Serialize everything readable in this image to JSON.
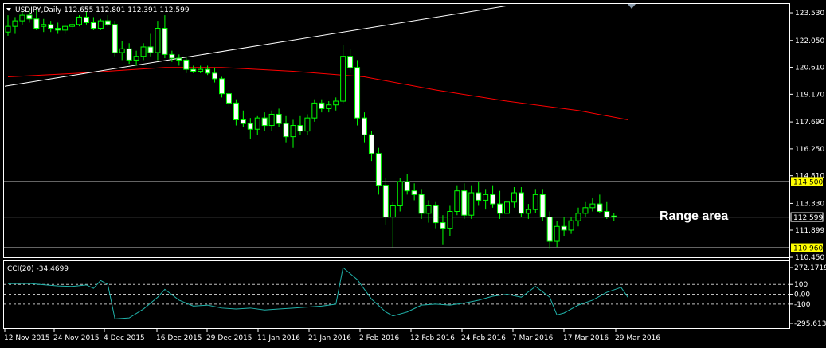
{
  "header": {
    "symbol_line": "USDJPY,Daily  112.655 112.801 112.391 112.599"
  },
  "price_axis": {
    "ticks": [
      "123.530",
      "122.050",
      "120.610",
      "119.170",
      "117.690",
      "116.250",
      "114.810",
      "113.330",
      "111.899",
      "110.450"
    ],
    "labels": [
      {
        "text": "114.500",
        "style": "yellow"
      },
      {
        "text": "112.599",
        "style": "white"
      },
      {
        "text": "110.960",
        "style": "yellow"
      }
    ]
  },
  "annotation": {
    "range_text": "Range area"
  },
  "cci": {
    "title": "CCI(20) -34.4699",
    "ticks": [
      "272.1719",
      "100",
      "0.00",
      "-100",
      "-295.6136"
    ]
  },
  "dates": [
    "12 Nov 2015",
    "24 Nov 2015",
    "4 Dec 2015",
    "16 Dec 2015",
    "29 Dec 2015",
    "11 Jan 2016",
    "21 Jan 2016",
    "2 Feb 2016",
    "12 Feb 2016",
    "24 Feb 2016",
    "7 Mar 2016",
    "17 Mar 2016",
    "29 Mar 2016"
  ],
  "colors": {
    "background": "#000000",
    "grid": "#ffffff",
    "bull_candle": "#000000",
    "bear_candle": "#ffffff",
    "wick": "#00ff00",
    "ma": "#ff0000",
    "trendline": "#ffffff",
    "cci_line": "#20b2aa",
    "level_label_bg": "#ffff00"
  },
  "chart_data": {
    "type": "candlestick",
    "symbol": "USDJPY",
    "timeframe": "Daily",
    "ylim": [
      110.45,
      124.0
    ],
    "candles": [
      {
        "o": 122.5,
        "h": 123.4,
        "l": 122.3,
        "c": 122.8
      },
      {
        "o": 122.8,
        "h": 123.3,
        "l": 122.4,
        "c": 123.1
      },
      {
        "o": 123.1,
        "h": 123.6,
        "l": 122.9,
        "c": 123.4
      },
      {
        "o": 123.4,
        "h": 123.8,
        "l": 123.0,
        "c": 123.2
      },
      {
        "o": 123.2,
        "h": 123.7,
        "l": 122.6,
        "c": 122.7
      },
      {
        "o": 122.8,
        "h": 123.2,
        "l": 122.5,
        "c": 122.9
      },
      {
        "o": 122.9,
        "h": 123.1,
        "l": 122.5,
        "c": 122.7
      },
      {
        "o": 122.7,
        "h": 123.0,
        "l": 122.4,
        "c": 122.6
      },
      {
        "o": 122.6,
        "h": 122.9,
        "l": 122.4,
        "c": 122.8
      },
      {
        "o": 122.8,
        "h": 123.1,
        "l": 122.6,
        "c": 122.9
      },
      {
        "o": 122.9,
        "h": 123.4,
        "l": 122.8,
        "c": 123.3
      },
      {
        "o": 123.3,
        "h": 123.6,
        "l": 122.9,
        "c": 123.0
      },
      {
        "o": 123.0,
        "h": 123.3,
        "l": 122.6,
        "c": 122.7
      },
      {
        "o": 122.7,
        "h": 123.2,
        "l": 122.6,
        "c": 123.1
      },
      {
        "o": 123.1,
        "h": 123.4,
        "l": 122.8,
        "c": 122.9
      },
      {
        "o": 122.9,
        "h": 123.1,
        "l": 121.2,
        "c": 121.4
      },
      {
        "o": 121.4,
        "h": 122.0,
        "l": 121.0,
        "c": 121.6
      },
      {
        "o": 121.6,
        "h": 121.9,
        "l": 120.8,
        "c": 121.0
      },
      {
        "o": 121.0,
        "h": 121.5,
        "l": 120.7,
        "c": 121.2
      },
      {
        "o": 121.2,
        "h": 121.9,
        "l": 121.0,
        "c": 121.7
      },
      {
        "o": 121.7,
        "h": 122.4,
        "l": 121.2,
        "c": 121.4
      },
      {
        "o": 121.4,
        "h": 123.1,
        "l": 121.0,
        "c": 122.7
      },
      {
        "o": 122.7,
        "h": 123.4,
        "l": 121.1,
        "c": 121.3
      },
      {
        "o": 121.3,
        "h": 121.5,
        "l": 120.9,
        "c": 121.1
      },
      {
        "o": 121.1,
        "h": 121.3,
        "l": 120.7,
        "c": 121.0
      },
      {
        "o": 121.0,
        "h": 121.2,
        "l": 120.3,
        "c": 120.5
      },
      {
        "o": 120.5,
        "h": 120.7,
        "l": 120.3,
        "c": 120.4
      },
      {
        "o": 120.4,
        "h": 120.7,
        "l": 120.3,
        "c": 120.5
      },
      {
        "o": 120.5,
        "h": 120.7,
        "l": 120.2,
        "c": 120.3
      },
      {
        "o": 120.3,
        "h": 120.6,
        "l": 119.8,
        "c": 120.0
      },
      {
        "o": 120.0,
        "h": 120.1,
        "l": 119.0,
        "c": 119.2
      },
      {
        "o": 119.2,
        "h": 119.4,
        "l": 118.5,
        "c": 118.7
      },
      {
        "o": 118.7,
        "h": 118.9,
        "l": 117.5,
        "c": 117.8
      },
      {
        "o": 117.8,
        "h": 118.3,
        "l": 117.4,
        "c": 117.6
      },
      {
        "o": 117.6,
        "h": 117.9,
        "l": 116.8,
        "c": 117.3
      },
      {
        "o": 117.3,
        "h": 118.0,
        "l": 117.0,
        "c": 117.9
      },
      {
        "o": 117.9,
        "h": 118.2,
        "l": 117.2,
        "c": 117.5
      },
      {
        "o": 117.5,
        "h": 118.3,
        "l": 117.2,
        "c": 118.1
      },
      {
        "o": 118.1,
        "h": 118.4,
        "l": 117.4,
        "c": 117.6
      },
      {
        "o": 117.6,
        "h": 118.0,
        "l": 116.6,
        "c": 116.9
      },
      {
        "o": 116.9,
        "h": 117.8,
        "l": 116.3,
        "c": 117.5
      },
      {
        "o": 117.5,
        "h": 118.0,
        "l": 117.0,
        "c": 117.2
      },
      {
        "o": 117.2,
        "h": 118.1,
        "l": 117.0,
        "c": 117.9
      },
      {
        "o": 117.9,
        "h": 118.9,
        "l": 117.7,
        "c": 118.7
      },
      {
        "o": 118.7,
        "h": 118.9,
        "l": 118.2,
        "c": 118.4
      },
      {
        "o": 118.4,
        "h": 118.8,
        "l": 118.2,
        "c": 118.6
      },
      {
        "o": 118.6,
        "h": 119.0,
        "l": 118.3,
        "c": 118.8
      },
      {
        "o": 118.8,
        "h": 121.8,
        "l": 118.7,
        "c": 121.2
      },
      {
        "o": 121.2,
        "h": 121.6,
        "l": 120.3,
        "c": 120.6
      },
      {
        "o": 120.6,
        "h": 121.0,
        "l": 117.5,
        "c": 117.9
      },
      {
        "o": 117.9,
        "h": 118.2,
        "l": 116.6,
        "c": 117.0
      },
      {
        "o": 117.0,
        "h": 117.2,
        "l": 115.6,
        "c": 116.0
      },
      {
        "o": 116.0,
        "h": 116.3,
        "l": 113.8,
        "c": 114.3
      },
      {
        "o": 114.3,
        "h": 114.7,
        "l": 112.2,
        "c": 112.6
      },
      {
        "o": 112.6,
        "h": 113.4,
        "l": 110.99,
        "c": 113.2
      },
      {
        "o": 113.2,
        "h": 114.7,
        "l": 112.9,
        "c": 114.5
      },
      {
        "o": 114.5,
        "h": 114.9,
        "l": 113.8,
        "c": 114.0
      },
      {
        "o": 114.0,
        "h": 114.4,
        "l": 113.5,
        "c": 113.8
      },
      {
        "o": 113.8,
        "h": 114.1,
        "l": 112.5,
        "c": 112.8
      },
      {
        "o": 112.8,
        "h": 113.5,
        "l": 112.3,
        "c": 113.2
      },
      {
        "o": 113.2,
        "h": 113.4,
        "l": 112.0,
        "c": 112.3
      },
      {
        "o": 112.3,
        "h": 112.7,
        "l": 111.1,
        "c": 112.0
      },
      {
        "o": 112.0,
        "h": 113.2,
        "l": 111.6,
        "c": 112.9
      },
      {
        "o": 112.9,
        "h": 114.3,
        "l": 112.7,
        "c": 114.0
      },
      {
        "o": 114.0,
        "h": 114.4,
        "l": 112.5,
        "c": 112.7
      },
      {
        "o": 112.7,
        "h": 114.3,
        "l": 112.5,
        "c": 113.9
      },
      {
        "o": 113.9,
        "h": 114.5,
        "l": 113.2,
        "c": 113.5
      },
      {
        "o": 113.5,
        "h": 114.1,
        "l": 113.0,
        "c": 113.8
      },
      {
        "o": 113.8,
        "h": 114.3,
        "l": 113.1,
        "c": 113.3
      },
      {
        "o": 113.3,
        "h": 114.0,
        "l": 112.5,
        "c": 112.8
      },
      {
        "o": 112.8,
        "h": 113.6,
        "l": 112.6,
        "c": 113.4
      },
      {
        "o": 113.4,
        "h": 114.2,
        "l": 113.1,
        "c": 113.9
      },
      {
        "o": 113.9,
        "h": 114.2,
        "l": 112.6,
        "c": 112.8
      },
      {
        "o": 112.8,
        "h": 113.3,
        "l": 112.5,
        "c": 113.0
      },
      {
        "o": 113.0,
        "h": 114.1,
        "l": 112.8,
        "c": 113.8
      },
      {
        "o": 113.8,
        "h": 114.1,
        "l": 112.4,
        "c": 112.6
      },
      {
        "o": 112.6,
        "h": 112.9,
        "l": 110.9,
        "c": 111.3
      },
      {
        "o": 111.3,
        "h": 112.4,
        "l": 111.0,
        "c": 112.1
      },
      {
        "o": 112.1,
        "h": 112.6,
        "l": 111.6,
        "c": 111.9
      },
      {
        "o": 111.9,
        "h": 112.6,
        "l": 111.7,
        "c": 112.4
      },
      {
        "o": 112.4,
        "h": 113.1,
        "l": 112.1,
        "c": 112.8
      },
      {
        "o": 112.8,
        "h": 113.4,
        "l": 112.6,
        "c": 113.1
      },
      {
        "o": 113.1,
        "h": 113.6,
        "l": 112.9,
        "c": 113.3
      },
      {
        "o": 113.3,
        "h": 113.8,
        "l": 112.8,
        "c": 112.9
      },
      {
        "o": 112.9,
        "h": 113.4,
        "l": 112.5,
        "c": 112.6
      },
      {
        "o": 112.655,
        "h": 112.801,
        "l": 112.391,
        "c": 112.599
      }
    ],
    "ma": [
      {
        "i": 0,
        "v": 120.1
      },
      {
        "i": 10,
        "v": 120.3
      },
      {
        "i": 22,
        "v": 120.6
      },
      {
        "i": 30,
        "v": 120.6
      },
      {
        "i": 40,
        "v": 120.4
      },
      {
        "i": 50,
        "v": 120.1
      },
      {
        "i": 60,
        "v": 119.4
      },
      {
        "i": 70,
        "v": 118.8
      },
      {
        "i": 80,
        "v": 118.3
      },
      {
        "i": 87,
        "v": 117.8
      }
    ],
    "trendline": [
      {
        "i": 0,
        "v": 119.6
      },
      {
        "i": 70,
        "v": 123.9
      }
    ],
    "levels": [
      114.5,
      112.599,
      110.96
    ],
    "cci_values": [
      {
        "i": 0,
        "v": 108
      },
      {
        "i": 3,
        "v": 110
      },
      {
        "i": 5,
        "v": 97
      },
      {
        "i": 7,
        "v": 85
      },
      {
        "i": 9,
        "v": 80
      },
      {
        "i": 11,
        "v": 95
      },
      {
        "i": 12,
        "v": 60
      },
      {
        "i": 13,
        "v": 140
      },
      {
        "i": 14,
        "v": 100
      },
      {
        "i": 15,
        "v": -250
      },
      {
        "i": 17,
        "v": -240
      },
      {
        "i": 19,
        "v": -150
      },
      {
        "i": 21,
        "v": -30
      },
      {
        "i": 22,
        "v": 50
      },
      {
        "i": 24,
        "v": -60
      },
      {
        "i": 26,
        "v": -120
      },
      {
        "i": 28,
        "v": -110
      },
      {
        "i": 30,
        "v": -140
      },
      {
        "i": 32,
        "v": -150
      },
      {
        "i": 34,
        "v": -140
      },
      {
        "i": 36,
        "v": -160
      },
      {
        "i": 38,
        "v": -150
      },
      {
        "i": 40,
        "v": -140
      },
      {
        "i": 42,
        "v": -130
      },
      {
        "i": 44,
        "v": -120
      },
      {
        "i": 46,
        "v": -100
      },
      {
        "i": 47,
        "v": 272
      },
      {
        "i": 49,
        "v": 150
      },
      {
        "i": 51,
        "v": -50
      },
      {
        "i": 53,
        "v": -180
      },
      {
        "i": 54,
        "v": -220
      },
      {
        "i": 56,
        "v": -180
      },
      {
        "i": 58,
        "v": -110
      },
      {
        "i": 60,
        "v": -100
      },
      {
        "i": 62,
        "v": -110
      },
      {
        "i": 64,
        "v": -90
      },
      {
        "i": 66,
        "v": -60
      },
      {
        "i": 68,
        "v": -20
      },
      {
        "i": 70,
        "v": 0
      },
      {
        "i": 72,
        "v": -30
      },
      {
        "i": 74,
        "v": 80
      },
      {
        "i": 76,
        "v": -30
      },
      {
        "i": 77,
        "v": -210
      },
      {
        "i": 78,
        "v": -190
      },
      {
        "i": 80,
        "v": -110
      },
      {
        "i": 82,
        "v": -60
      },
      {
        "i": 84,
        "v": 20
      },
      {
        "i": 86,
        "v": 70
      },
      {
        "i": 87,
        "v": -34.47
      }
    ],
    "cci_ylim": [
      -295.6136,
      272.1719
    ],
    "cci_levels": [
      100,
      0,
      -100
    ]
  }
}
